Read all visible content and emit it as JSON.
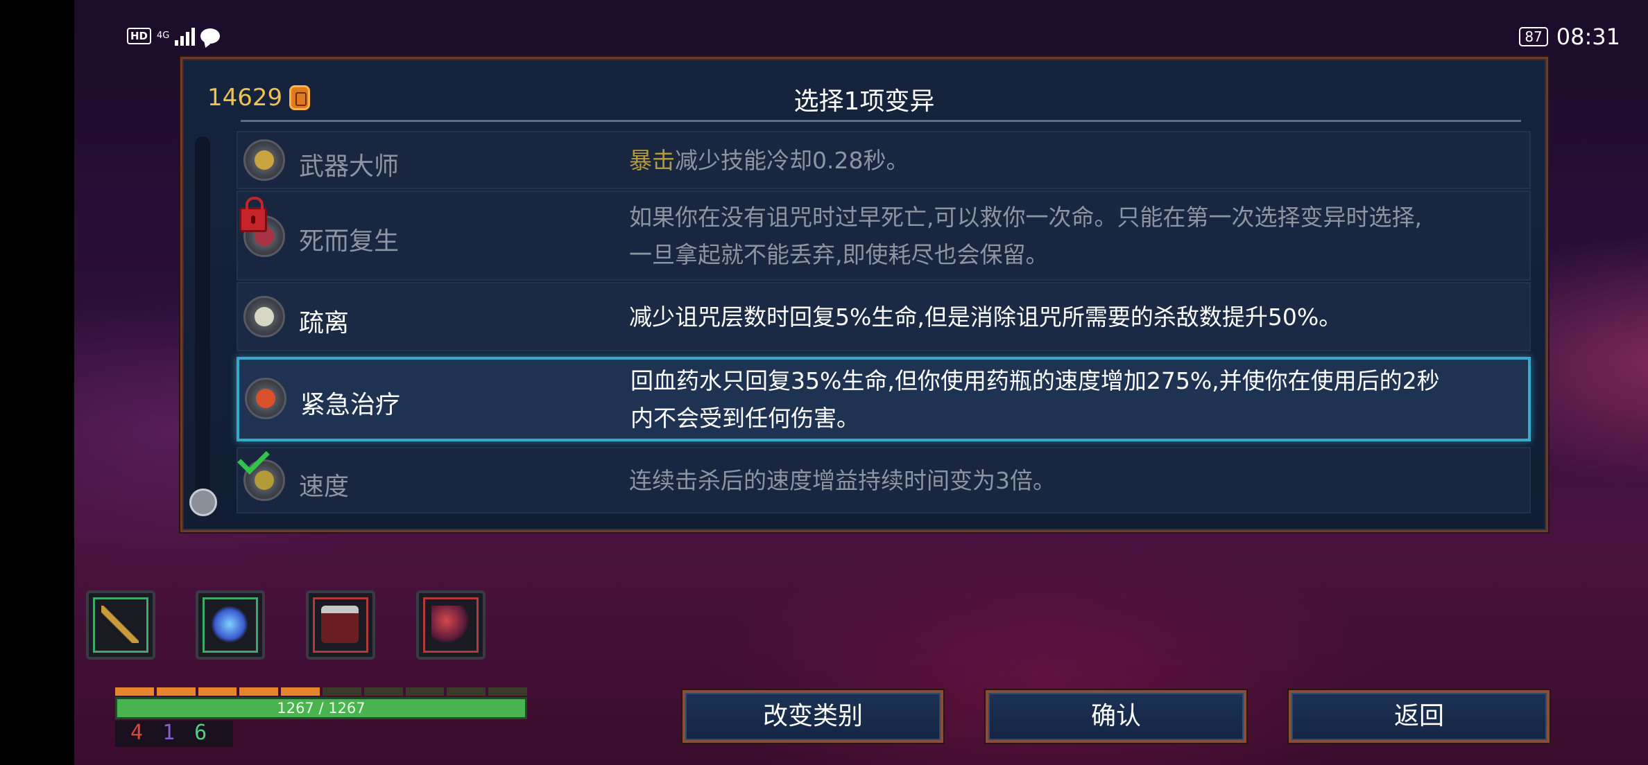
{
  "status_bar": {
    "hd_label": "HD",
    "network": "4G",
    "battery": "87",
    "time": "08:31"
  },
  "panel": {
    "gold": "14629",
    "title": "选择1项变异"
  },
  "mutations": [
    {
      "name": "武器大师",
      "desc_highlight": "暴击",
      "desc": "减少技能冷却0.28秒。",
      "icon": "weapon-master-icon",
      "state": "dim"
    },
    {
      "name": "死而复生",
      "desc": "如果你在没有诅咒时过早死亡,可以救你一次命。只能在第一次选择变异时选择,一旦拿起就不能丢弃,即使耗尽也会保留。",
      "icon": "heart-revive-icon",
      "state": "locked"
    },
    {
      "name": "疏离",
      "desc": "减少诅咒层数时回复5%生命,但是消除诅咒所需要的杀敌数提升50%。",
      "icon": "skull-icon",
      "state": "available"
    },
    {
      "name": "紧急治疗",
      "desc": "回血药水只回复35%生命,但你使用药瓶的速度增加275%,并使你在使用后的2秒内不会受到任何伤害。",
      "icon": "potion-icon",
      "state": "selected"
    },
    {
      "name": "速度",
      "desc": "连续击杀后的速度增益持续时间变为3倍。",
      "icon": "speed-arrows-icon",
      "state": "owned"
    }
  ],
  "inventory": [
    {
      "icon": "bow-icon",
      "frame_color": "#3fa86a"
    },
    {
      "icon": "crystal-icon",
      "frame_color": "#3fa86a"
    },
    {
      "icon": "turret-icon",
      "frame_color": "#b23a3a"
    },
    {
      "icon": "dragon-icon",
      "frame_color": "#b23a3a"
    }
  ],
  "hud": {
    "health": "1267 / 1267",
    "health_fraction": 1.0,
    "stats": {
      "brutality": "4",
      "tactics": "1",
      "survival": "6"
    },
    "stat_colors": {
      "brutality": "#e0453a",
      "tactics": "#8a5bd6",
      "survival": "#4fd07a"
    }
  },
  "buttons": {
    "change_category": "改变类别",
    "confirm": "确认",
    "back": "返回"
  },
  "colors": {
    "selected_border": "#3aa9c9",
    "gold": "#f0c050",
    "highlight_text": "#b5993a"
  }
}
